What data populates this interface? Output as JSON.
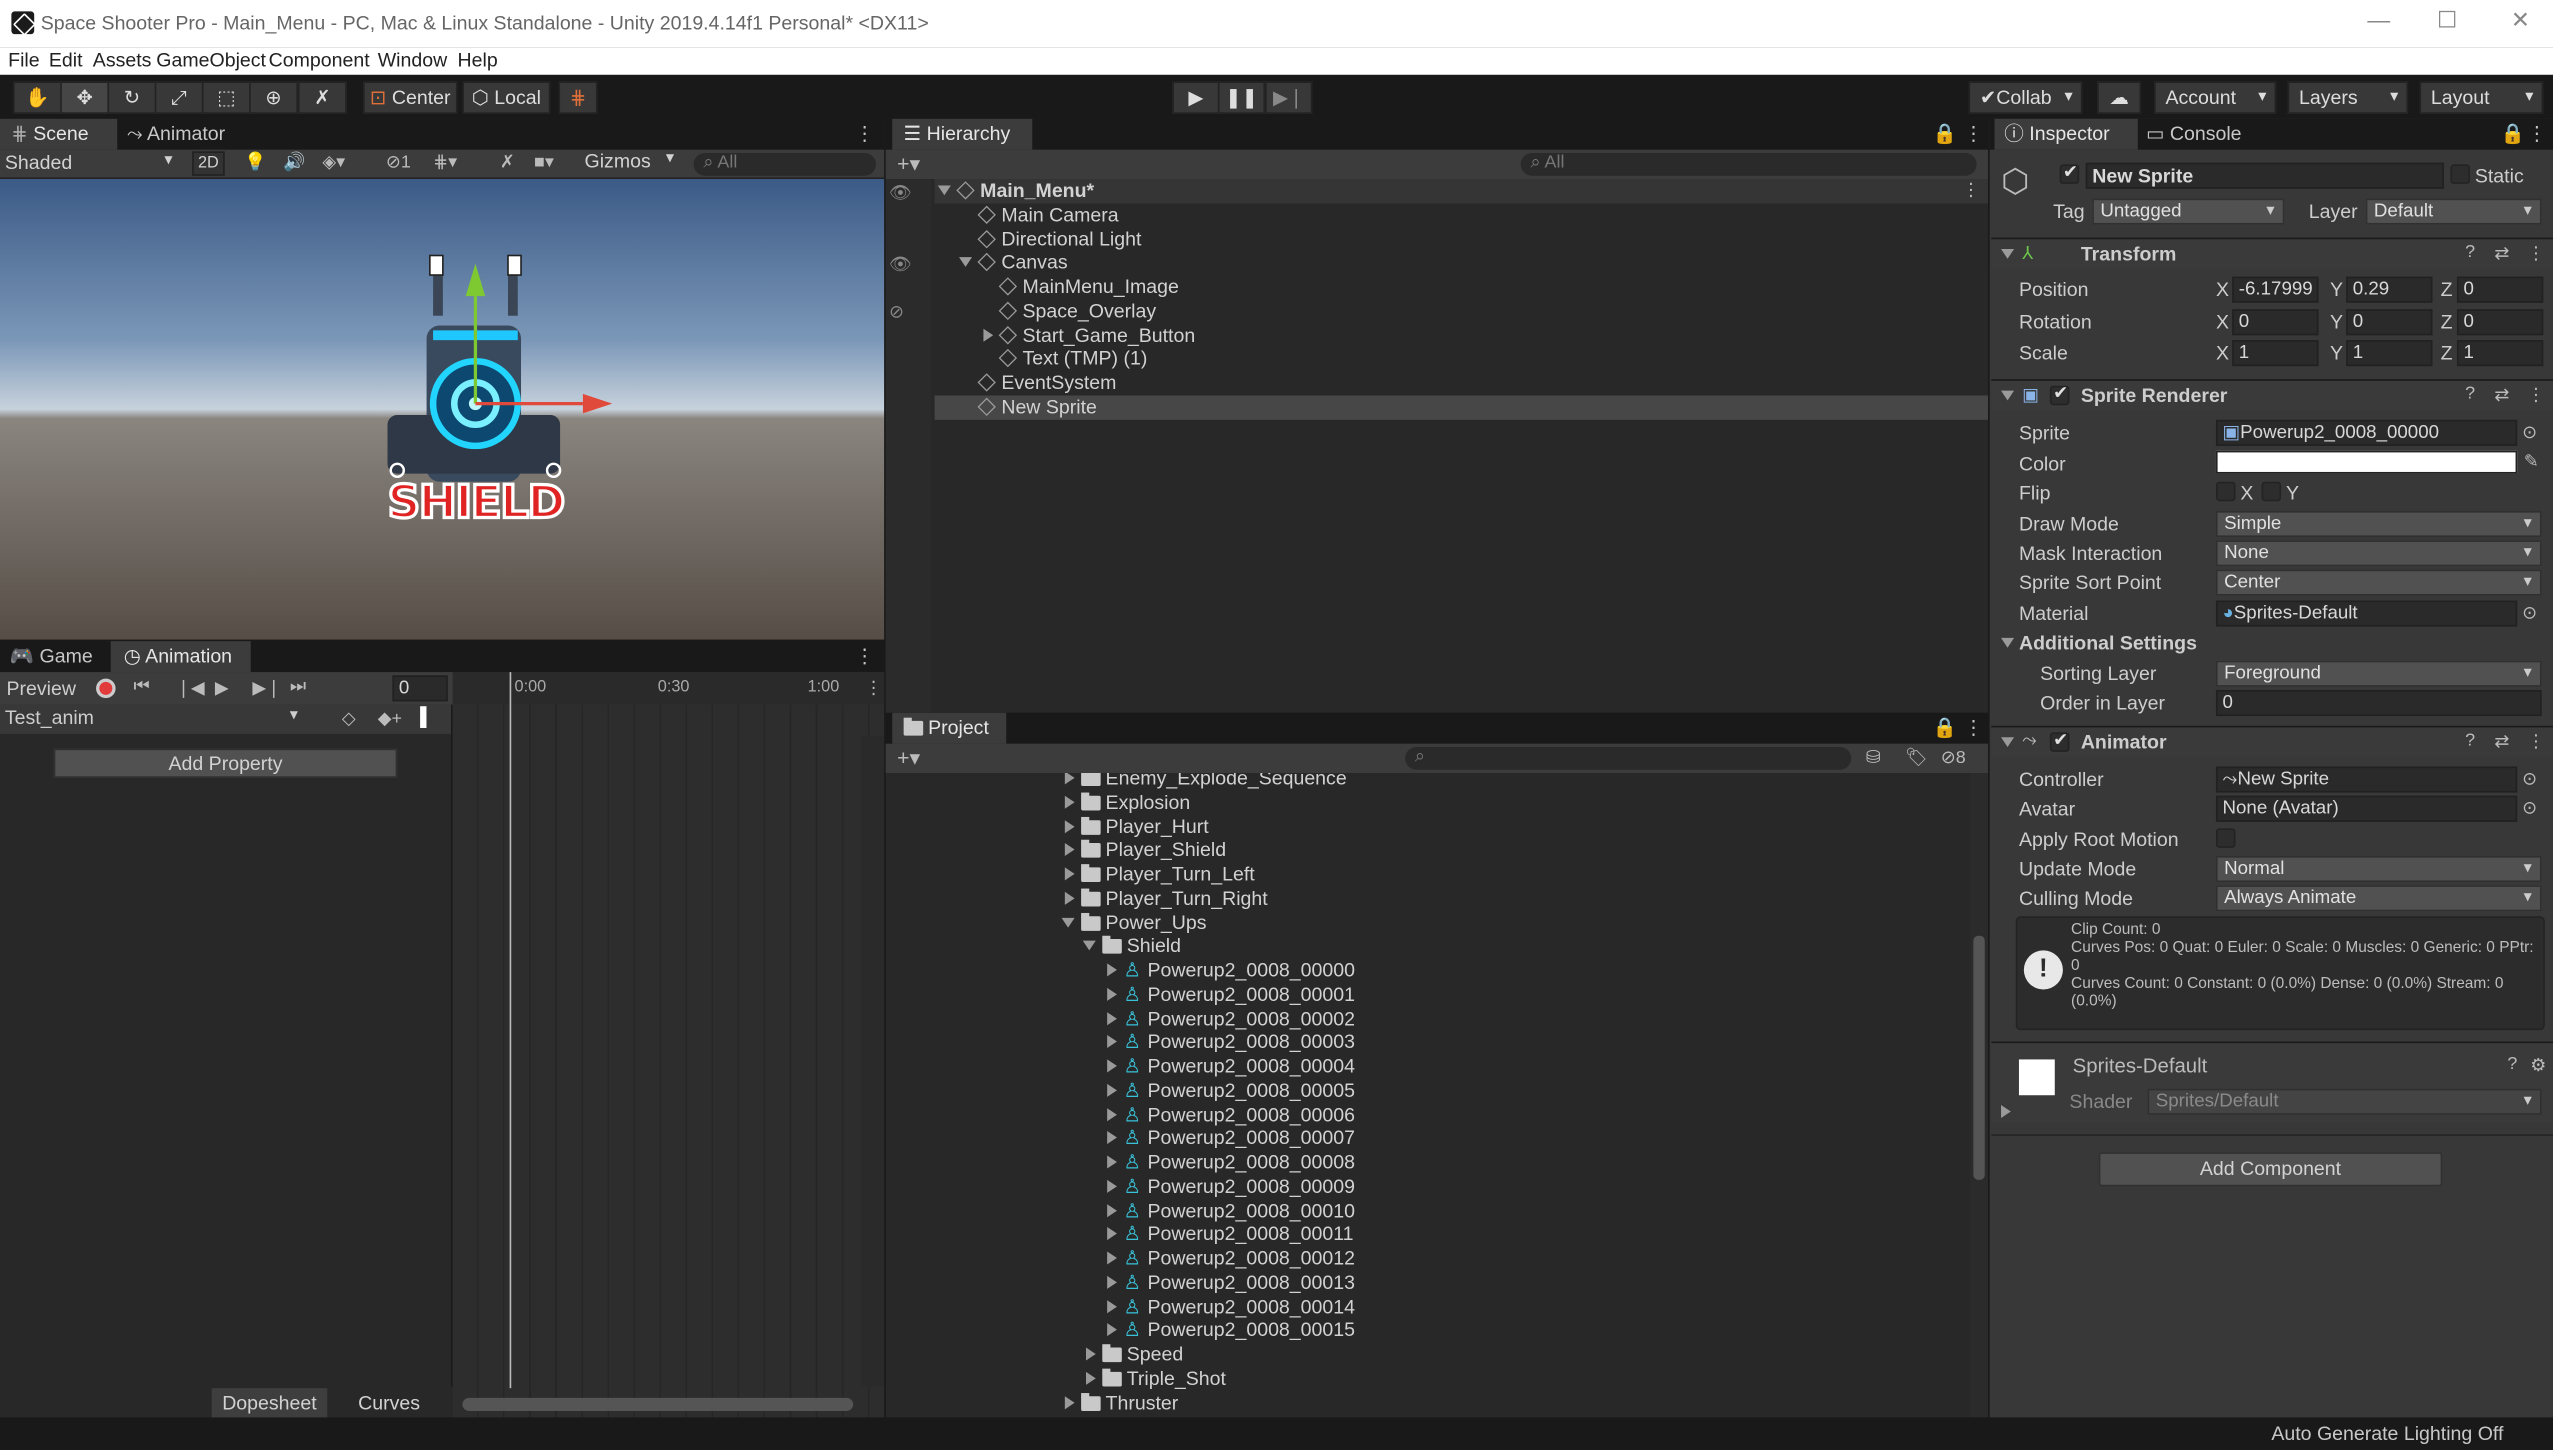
{
  "titlebar": {
    "title": "Space Shooter Pro - Main_Menu - PC, Mac & Linux Standalone - Unity 2019.4.14f1 Personal* <DX11>",
    "minimize": "—",
    "maximize": "☐",
    "close": "✕"
  },
  "menu": [
    "File",
    "Edit",
    "Assets",
    "GameObject",
    "Component",
    "Window",
    "Help"
  ],
  "toolbar": {
    "center": "Center",
    "local": "Local",
    "collab": "Collab",
    "account": "Account",
    "layers": "Layers",
    "layout": "Layout"
  },
  "scene": {
    "tab_scene": "Scene",
    "tab_animator": "Animator",
    "shading": "Shaded",
    "mode_2d": "2D",
    "hidden_count": "1",
    "gizmos": "Gizmos",
    "search_placeholder": "All",
    "shield_text": "SHIELD"
  },
  "animation": {
    "tab_game": "Game",
    "tab_animation": "Animation",
    "preview": "Preview",
    "frame": "0",
    "clip": "Test_anim",
    "add_property": "Add Property",
    "ticks": [
      "0:00",
      "0:30",
      "1:00"
    ],
    "dopesheet": "Dopesheet",
    "curves": "Curves"
  },
  "hierarchy": {
    "tab": "Hierarchy",
    "search_placeholder": "All",
    "items": [
      {
        "label": "Main_Menu*",
        "depth": 0,
        "expanded": true,
        "scene": true
      },
      {
        "label": "Main Camera",
        "depth": 1
      },
      {
        "label": "Directional Light",
        "depth": 1
      },
      {
        "label": "Canvas",
        "depth": 1,
        "expanded": true
      },
      {
        "label": "MainMenu_Image",
        "depth": 2
      },
      {
        "label": "Space_Overlay",
        "depth": 2
      },
      {
        "label": "Start_Game_Button",
        "depth": 2,
        "collapsed": true
      },
      {
        "label": "Text (TMP) (1)",
        "depth": 2
      },
      {
        "label": "EventSystem",
        "depth": 1
      },
      {
        "label": "New Sprite",
        "depth": 1,
        "selected": true
      }
    ]
  },
  "project": {
    "tab": "Project",
    "hidden_count": "8",
    "items": [
      {
        "label": "Enemy_Explode_Sequence",
        "depth": 0,
        "type": "folder"
      },
      {
        "label": "Explosion",
        "depth": 0,
        "type": "folder"
      },
      {
        "label": "Player_Hurt",
        "depth": 0,
        "type": "folder"
      },
      {
        "label": "Player_Shield",
        "depth": 0,
        "type": "folder"
      },
      {
        "label": "Player_Turn_Left",
        "depth": 0,
        "type": "folder"
      },
      {
        "label": "Player_Turn_Right",
        "depth": 0,
        "type": "folder"
      },
      {
        "label": "Power_Ups",
        "depth": 0,
        "type": "folder",
        "expanded": true
      },
      {
        "label": "Shield",
        "depth": 1,
        "type": "folder",
        "expanded": true
      },
      {
        "label": "Powerup2_0008_00000",
        "depth": 2,
        "type": "sprite"
      },
      {
        "label": "Powerup2_0008_00001",
        "depth": 2,
        "type": "sprite"
      },
      {
        "label": "Powerup2_0008_00002",
        "depth": 2,
        "type": "sprite"
      },
      {
        "label": "Powerup2_0008_00003",
        "depth": 2,
        "type": "sprite"
      },
      {
        "label": "Powerup2_0008_00004",
        "depth": 2,
        "type": "sprite"
      },
      {
        "label": "Powerup2_0008_00005",
        "depth": 2,
        "type": "sprite"
      },
      {
        "label": "Powerup2_0008_00006",
        "depth": 2,
        "type": "sprite"
      },
      {
        "label": "Powerup2_0008_00007",
        "depth": 2,
        "type": "sprite"
      },
      {
        "label": "Powerup2_0008_00008",
        "depth": 2,
        "type": "sprite"
      },
      {
        "label": "Powerup2_0008_00009",
        "depth": 2,
        "type": "sprite"
      },
      {
        "label": "Powerup2_0008_00010",
        "depth": 2,
        "type": "sprite"
      },
      {
        "label": "Powerup2_0008_00011",
        "depth": 2,
        "type": "sprite"
      },
      {
        "label": "Powerup2_0008_00012",
        "depth": 2,
        "type": "sprite"
      },
      {
        "label": "Powerup2_0008_00013",
        "depth": 2,
        "type": "sprite"
      },
      {
        "label": "Powerup2_0008_00014",
        "depth": 2,
        "type": "sprite"
      },
      {
        "label": "Powerup2_0008_00015",
        "depth": 2,
        "type": "sprite"
      },
      {
        "label": "Speed",
        "depth": 1,
        "type": "folder"
      },
      {
        "label": "Triple_Shot",
        "depth": 1,
        "type": "folder"
      },
      {
        "label": "Thruster",
        "depth": 0,
        "type": "folder"
      }
    ]
  },
  "inspector": {
    "tab_inspector": "Inspector",
    "tab_console": "Console",
    "object_name": "New Sprite",
    "static": "Static",
    "tag_label": "Tag",
    "tag": "Untagged",
    "layer_label": "Layer",
    "layer": "Default",
    "transform": {
      "title": "Transform",
      "position_label": "Position",
      "rotation_label": "Rotation",
      "scale_label": "Scale",
      "position": {
        "x": "-6.17999",
        "y": "0.29",
        "z": "0"
      },
      "rotation": {
        "x": "0",
        "y": "0",
        "z": "0"
      },
      "scale": {
        "x": "1",
        "y": "1",
        "z": "1"
      }
    },
    "sprite_renderer": {
      "title": "Sprite Renderer",
      "sprite_label": "Sprite",
      "sprite": "Powerup2_0008_00000",
      "color_label": "Color",
      "color": "#ffffff",
      "flip_label": "Flip",
      "flip_x": "X",
      "flip_y": "Y",
      "draw_mode_label": "Draw Mode",
      "draw_mode": "Simple",
      "mask_label": "Mask Interaction",
      "mask": "None",
      "sort_point_label": "Sprite Sort Point",
      "sort_point": "Center",
      "material_label": "Material",
      "material": "Sprites-Default",
      "additional": "Additional Settings",
      "sorting_layer_label": "Sorting Layer",
      "sorting_layer": "Foreground",
      "order_label": "Order in Layer",
      "order": "0"
    },
    "animator": {
      "title": "Animator",
      "controller_label": "Controller",
      "controller": "New Sprite",
      "avatar_label": "Avatar",
      "avatar": "None (Avatar)",
      "root_motion_label": "Apply Root Motion",
      "update_label": "Update Mode",
      "update": "Normal",
      "culling_label": "Culling Mode",
      "culling": "Always Animate",
      "info": "Clip Count: 0\nCurves Pos: 0 Quat: 0 Euler: 0 Scale: 0 Muscles: 0 Generic: 0 PPtr: 0\nCurves Count: 0 Constant: 0 (0.0%) Dense: 0 (0.0%) Stream: 0 (0.0%)"
    },
    "material": {
      "name": "Sprites-Default",
      "shader_label": "Shader",
      "shader": "Sprites/Default"
    },
    "add_component": "Add Component"
  },
  "statusbar": {
    "text": "Auto Generate Lighting Off"
  }
}
